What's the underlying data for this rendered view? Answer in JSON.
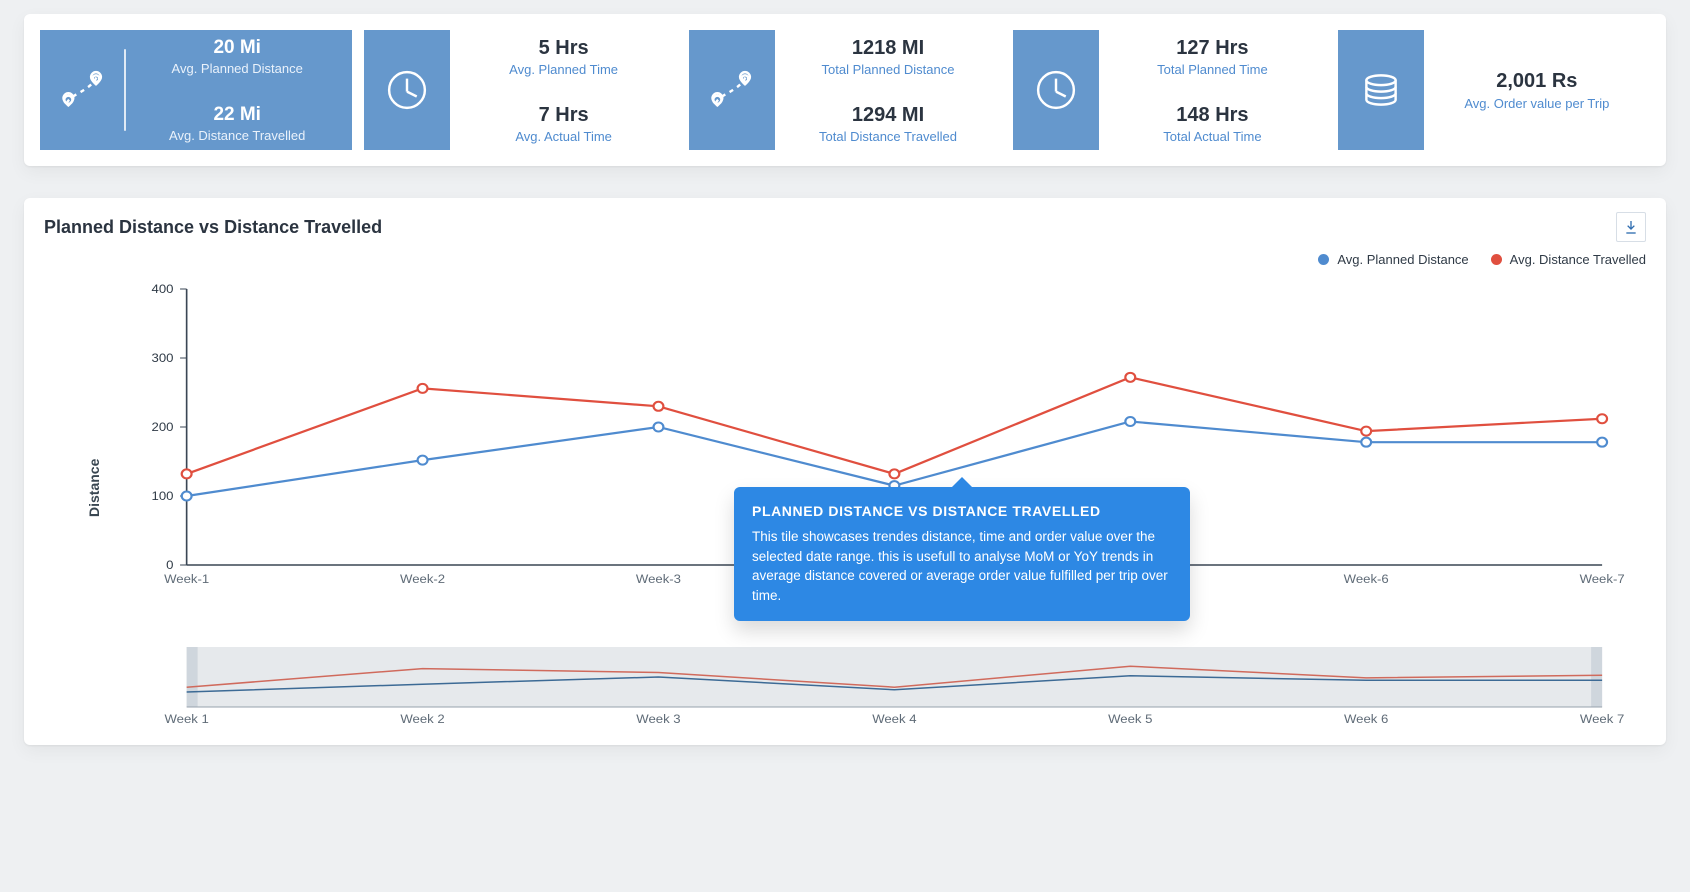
{
  "colors": {
    "blue": "#4f8bcf",
    "red": "#e04f3f",
    "softBlue": "#6698cc",
    "tooltip": "#2d88e4"
  },
  "kpis": [
    {
      "icon": "route-icon",
      "variant": "blue-full",
      "rows": [
        {
          "value": "20 Mi",
          "label": "Avg. Planned Distance"
        },
        {
          "value": "22 Mi",
          "label": "Avg. Distance Travelled"
        }
      ]
    },
    {
      "icon": "clock-icon",
      "rows": [
        {
          "value": "5 Hrs",
          "label": "Avg. Planned Time"
        },
        {
          "value": "7 Hrs",
          "label": "Avg. Actual Time"
        }
      ]
    },
    {
      "icon": "route-icon",
      "rows": [
        {
          "value": "1218 MI",
          "label": "Total Planned Distance"
        },
        {
          "value": "1294 MI",
          "label": "Total Distance Travelled"
        }
      ]
    },
    {
      "icon": "clock-icon",
      "rows": [
        {
          "value": "127 Hrs",
          "label": "Total Planned Time"
        },
        {
          "value": "148 Hrs",
          "label": "Total Actual Time"
        }
      ]
    },
    {
      "icon": "coins-icon",
      "variant": "single",
      "rows": [
        {
          "value": "2,001 Rs",
          "label": "Avg. Order value per Trip"
        }
      ]
    }
  ],
  "chart": {
    "title": "Planned Distance vs Distance Travelled",
    "legend": [
      {
        "name": "Avg. Planned Distance",
        "color": "#4f8bcf"
      },
      {
        "name": "Avg. Distance Travelled",
        "color": "#e04f3f"
      }
    ],
    "ylabel": "Distance",
    "yticks": [
      0,
      100,
      200,
      300,
      400
    ],
    "categories": [
      "Week-1",
      "Week-2",
      "Week-3",
      "Week-4",
      "Week-5",
      "Week-6",
      "Week-7"
    ],
    "export_label": "Export"
  },
  "mini": {
    "categories": [
      "Week 1",
      "Week 2",
      "Week 3",
      "Week 4",
      "Week 5",
      "Week 6",
      "Week 7"
    ]
  },
  "tooltip": {
    "title": "PLANNED DISTANCE VS DISTANCE TRAVELLED",
    "body": "This tile showcases trendes distance, time and order value over the selected date range. this is usefull to analyse MoM or YoY trends in average distance covered or average order value fulfilled per trip over time."
  },
  "chart_data": {
    "type": "line",
    "title": "Planned Distance vs Distance Travelled",
    "xlabel": "",
    "ylabel": "Distance",
    "ylim": [
      0,
      400
    ],
    "categories": [
      "Week-1",
      "Week-2",
      "Week-3",
      "Week-4",
      "Week-5",
      "Week-6",
      "Week-7"
    ],
    "series": [
      {
        "name": "Avg. Planned Distance",
        "color": "#4f8bcf",
        "values": [
          100,
          152,
          200,
          115,
          208,
          178,
          178
        ]
      },
      {
        "name": "Avg. Distance Travelled",
        "color": "#e04f3f",
        "values": [
          132,
          256,
          230,
          132,
          272,
          194,
          212
        ]
      }
    ],
    "legend_position": "top-right"
  },
  "icons": {
    "route-icon": "route",
    "clock-icon": "clock",
    "coins-icon": "coins"
  }
}
